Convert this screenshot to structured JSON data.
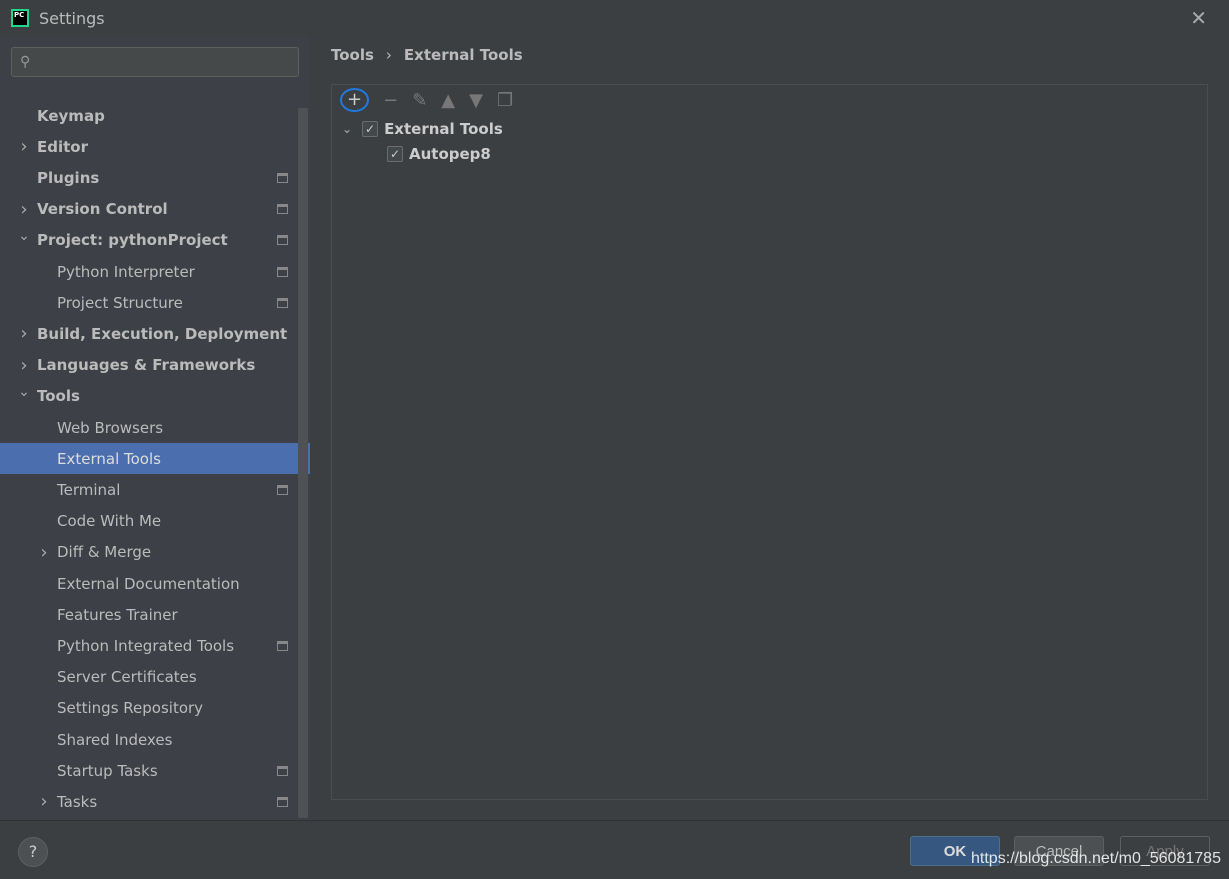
{
  "window": {
    "title": "Settings",
    "logo": "PC"
  },
  "search": {
    "placeholder": ""
  },
  "sidebar": {
    "items": [
      {
        "label": "Keymap",
        "level": 0,
        "bold": true,
        "arrow": "",
        "badge": false
      },
      {
        "label": "Editor",
        "level": 0,
        "bold": true,
        "arrow": "right",
        "badge": false
      },
      {
        "label": "Plugins",
        "level": 0,
        "bold": true,
        "arrow": "",
        "badge": true
      },
      {
        "label": "Version Control",
        "level": 0,
        "bold": true,
        "arrow": "right",
        "badge": true
      },
      {
        "label": "Project: pythonProject",
        "level": 0,
        "bold": true,
        "arrow": "down",
        "badge": true
      },
      {
        "label": "Python Interpreter",
        "level": 1,
        "bold": false,
        "arrow": "",
        "badge": true
      },
      {
        "label": "Project Structure",
        "level": 1,
        "bold": false,
        "arrow": "",
        "badge": true
      },
      {
        "label": "Build, Execution, Deployment",
        "level": 0,
        "bold": true,
        "arrow": "right",
        "badge": false
      },
      {
        "label": "Languages & Frameworks",
        "level": 0,
        "bold": true,
        "arrow": "right",
        "badge": false
      },
      {
        "label": "Tools",
        "level": 0,
        "bold": true,
        "arrow": "down",
        "badge": false
      },
      {
        "label": "Web Browsers",
        "level": 1,
        "bold": false,
        "arrow": "",
        "badge": false
      },
      {
        "label": "External Tools",
        "level": 1,
        "bold": false,
        "arrow": "",
        "badge": false,
        "selected": true
      },
      {
        "label": "Terminal",
        "level": 1,
        "bold": false,
        "arrow": "",
        "badge": true
      },
      {
        "label": "Code With Me",
        "level": 1,
        "bold": false,
        "arrow": "",
        "badge": false
      },
      {
        "label": "Diff & Merge",
        "level": 1,
        "bold": false,
        "arrow": "right",
        "badge": false
      },
      {
        "label": "External Documentation",
        "level": 1,
        "bold": false,
        "arrow": "",
        "badge": false
      },
      {
        "label": "Features Trainer",
        "level": 1,
        "bold": false,
        "arrow": "",
        "badge": false
      },
      {
        "label": "Python Integrated Tools",
        "level": 1,
        "bold": false,
        "arrow": "",
        "badge": true
      },
      {
        "label": "Server Certificates",
        "level": 1,
        "bold": false,
        "arrow": "",
        "badge": false
      },
      {
        "label": "Settings Repository",
        "level": 1,
        "bold": false,
        "arrow": "",
        "badge": false
      },
      {
        "label": "Shared Indexes",
        "level": 1,
        "bold": false,
        "arrow": "",
        "badge": false
      },
      {
        "label": "Startup Tasks",
        "level": 1,
        "bold": false,
        "arrow": "",
        "badge": true
      },
      {
        "label": "Tasks",
        "level": 1,
        "bold": false,
        "arrow": "right",
        "badge": true
      }
    ]
  },
  "breadcrumb": {
    "parent": "Tools",
    "sep": "›",
    "current": "External Tools"
  },
  "toolbar": {
    "icons": [
      "plus-icon",
      "minus-icon",
      "edit-icon",
      "move-up-icon",
      "move-down-icon",
      "copy-icon"
    ]
  },
  "tree": {
    "group": {
      "label": "External Tools",
      "checked": true
    },
    "child": {
      "label": "Autopep8",
      "checked": true
    }
  },
  "footer": {
    "help": "?",
    "ok": "OK",
    "cancel": "Cancel",
    "apply": "Apply"
  },
  "watermark": "https://blog.csdn.net/m0_56081785",
  "colors": {
    "selection": "#4b6eaf",
    "ok": "#365880",
    "annotation": "#1e7ae0"
  }
}
